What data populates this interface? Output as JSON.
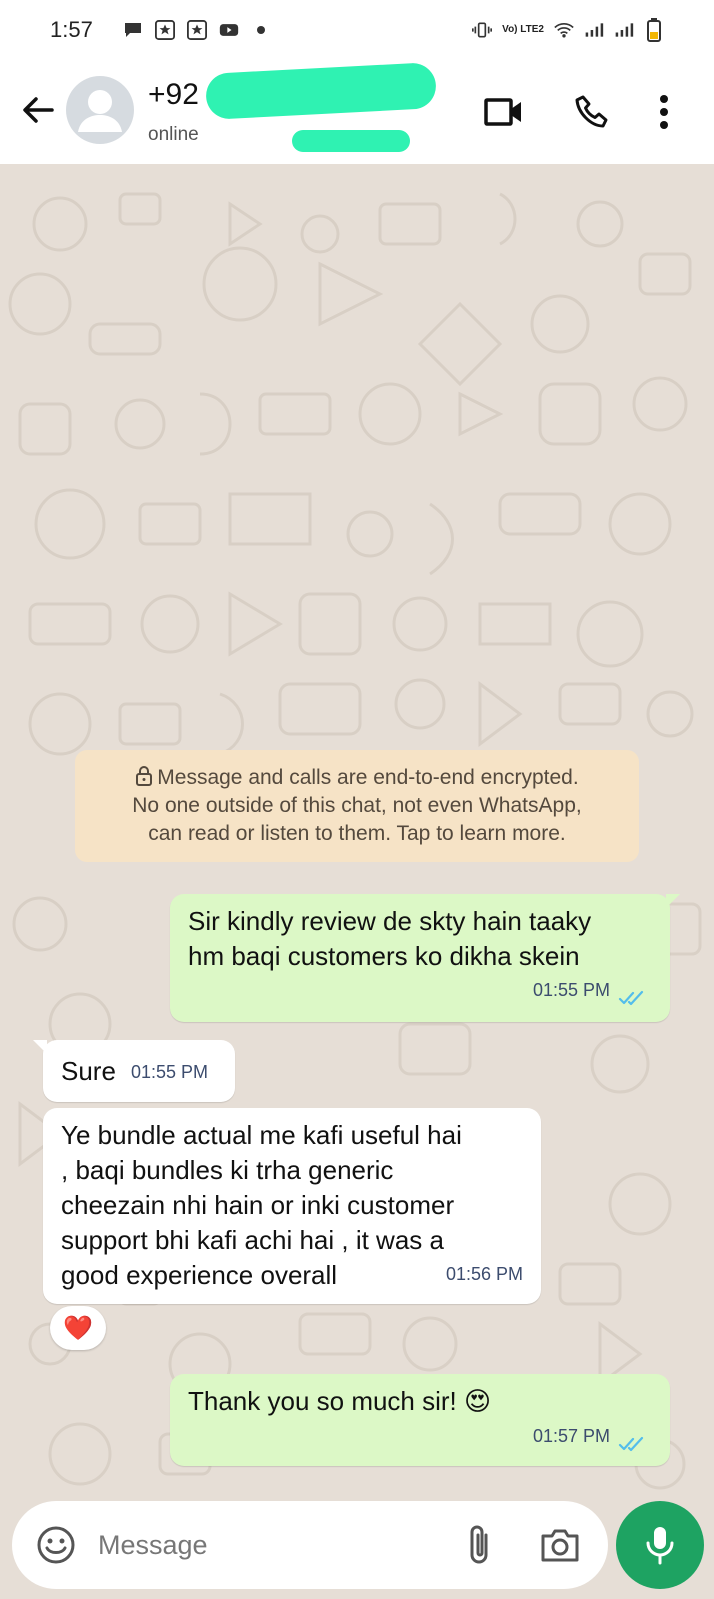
{
  "status_bar": {
    "time": "1:57",
    "volte_label": "Vo) LTE2"
  },
  "header": {
    "contact_name": "+92",
    "contact_status": "online"
  },
  "encryption_notice": {
    "line1": "Message and calls are end-to-end encrypted.",
    "line2": "No one outside of this chat, not even WhatsApp,",
    "line3": "can read or listen to them. Tap to learn more."
  },
  "messages": [
    {
      "direction": "outgoing",
      "lines": [
        "Sir kindly review de skty hain taaky",
        "hm baqi customers ko dikha skein"
      ],
      "time": "01:55 PM",
      "status": "read"
    },
    {
      "direction": "incoming",
      "lines": [
        "Sure"
      ],
      "time": "01:55 PM"
    },
    {
      "direction": "incoming",
      "lines": [
        "Ye bundle actual me kafi useful hai",
        ", baqi bundles ki trha generic",
        "cheezain nhi hain or inki customer",
        "support bhi kafi achi hai , it was a",
        "good experience overall"
      ],
      "time": "01:56 PM",
      "reaction": "❤️"
    },
    {
      "direction": "outgoing",
      "lines": [
        "Thank you so much sir! 😍"
      ],
      "time": "01:57 PM",
      "status": "read"
    }
  ],
  "input": {
    "placeholder": "Message"
  },
  "colors": {
    "outgoing_bubble": "#dcf8c6",
    "incoming_bubble": "#ffffff",
    "encryption_bg": "#f6e3c6",
    "mic_button": "#1ea362",
    "read_ticks": "#53bdeb",
    "redaction": "#2ff2b2"
  },
  "icons": [
    "back-arrow-icon",
    "avatar-placeholder-icon",
    "video-call-icon",
    "phone-icon",
    "more-vert-icon",
    "lock-icon",
    "double-check-icon",
    "emoji-icon",
    "attach-icon",
    "camera-icon",
    "mic-icon"
  ]
}
